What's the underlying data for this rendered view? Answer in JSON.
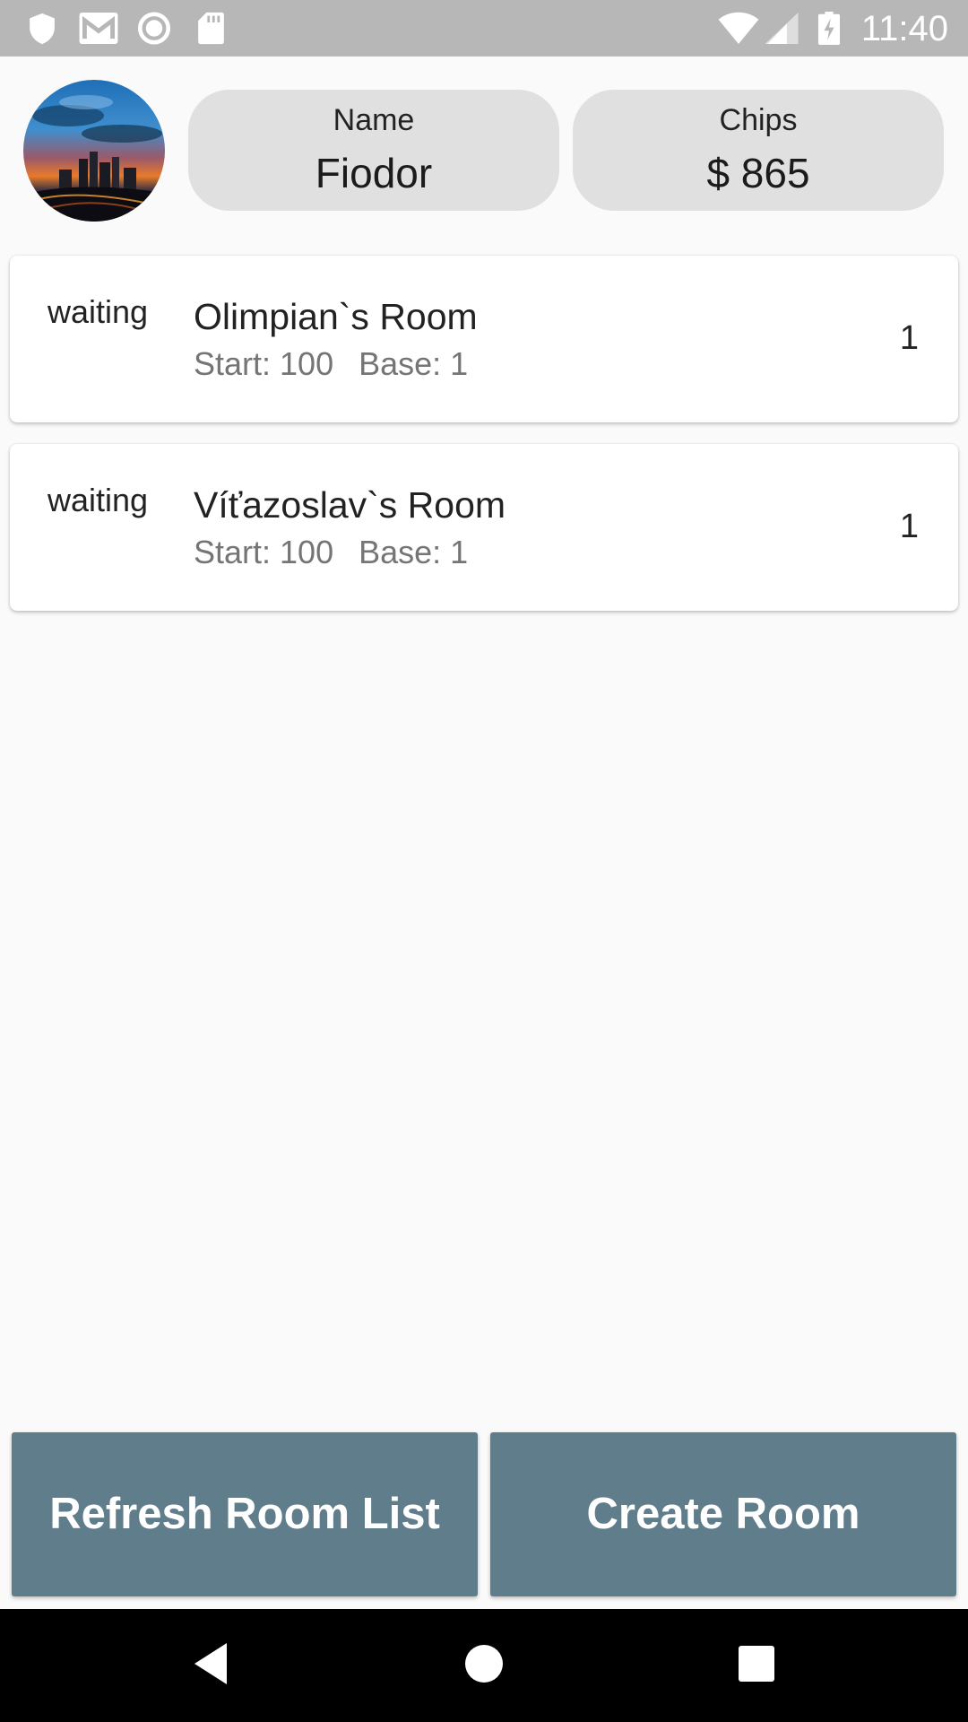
{
  "status_bar": {
    "time": "11:40",
    "left_icons": [
      "shield-icon",
      "gmail-icon",
      "record-icon",
      "sd-card-icon"
    ],
    "right_icons": [
      "wifi-icon",
      "signal-icon",
      "battery-charging-icon"
    ]
  },
  "profile": {
    "avatar": "avatar-city-sunset",
    "name_label": "Name",
    "name_value": "Fiodor",
    "chips_label": "Chips",
    "chips_value": "$ 865"
  },
  "rooms": [
    {
      "status": "waiting",
      "name": "Olimpian`s Room",
      "start": "Start: 100",
      "base": "Base: 1",
      "count": "1"
    },
    {
      "status": "waiting",
      "name": "Víťazoslav`s Room",
      "start": "Start: 100",
      "base": "Base: 1",
      "count": "1"
    }
  ],
  "actions": {
    "refresh_label": "Refresh Room List",
    "create_label": "Create Room"
  },
  "colors": {
    "status_bar": "#b7b7b7",
    "pill_background": "#e0e0e0",
    "button_background": "#607d8b",
    "nav_bar": "#000000",
    "page_background": "#fafafa"
  },
  "nav_bar": {
    "icons": [
      "back-icon",
      "home-icon",
      "recents-icon"
    ]
  }
}
